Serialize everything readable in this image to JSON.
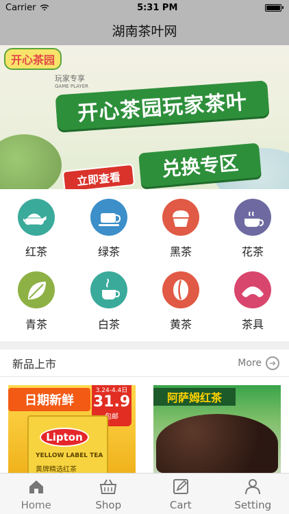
{
  "status": {
    "carrier": "Carrier",
    "time": "5:31 PM"
  },
  "nav": {
    "title": "湖南茶叶网"
  },
  "banner": {
    "logo": "开心茶园",
    "subtag": "玩家专享",
    "subtag_en": "GAME PLAYER",
    "main_title": "开心茶园玩家茶叶",
    "cta": "立即查看",
    "zone": "兑换专区",
    "active_index": 0,
    "dot_count": 6
  },
  "categories": [
    {
      "label": "红茶",
      "icon": "teapot-icon",
      "color": "#3aaa9b"
    },
    {
      "label": "绿茶",
      "icon": "tea-cup-icon",
      "color": "#3c8fc8"
    },
    {
      "label": "黑茶",
      "icon": "cupcake-icon",
      "color": "#e05a45"
    },
    {
      "label": "花茶",
      "icon": "steaming-cup-icon",
      "color": "#6e6aa1"
    },
    {
      "label": "青茶",
      "icon": "leaf-icon",
      "color": "#8db144"
    },
    {
      "label": "白茶",
      "icon": "coffee-cup-icon",
      "color": "#3aaa9b"
    },
    {
      "label": "黄茶",
      "icon": "bean-icon",
      "color": "#e05a45"
    },
    {
      "label": "茶具",
      "icon": "croissant-icon",
      "color": "#d9466d"
    }
  ],
  "new_products": {
    "title": "新品上市",
    "more_label": "More"
  },
  "products": [
    {
      "banner": "日期新鲜",
      "price_date": "3.24-4.4日",
      "price": "31.9",
      "price_note": "包邮",
      "brand": "Lipton",
      "sub_en": "YELLOW LABEL TEA",
      "sub_cn": "黄牌精选红茶"
    },
    {
      "title": "阿萨姆红茶"
    }
  ],
  "tabs": [
    {
      "label": "Home",
      "icon": "home-icon"
    },
    {
      "label": "Shop",
      "icon": "basket-icon"
    },
    {
      "label": "Cart",
      "icon": "edit-icon"
    },
    {
      "label": "Setting",
      "icon": "user-icon"
    }
  ]
}
